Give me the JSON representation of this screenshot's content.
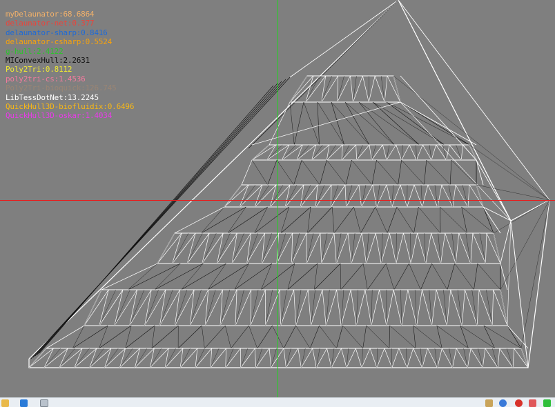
{
  "timings": [
    {
      "label": "myDelaunator:68.6864",
      "color": "#f0b06a"
    },
    {
      "label": "delaunator-net:0.377",
      "color": "#e8453c"
    },
    {
      "label": "delaunator-sharp:0.8416",
      "color": "#1f6bd6"
    },
    {
      "label": "delaunator-csharp:0.5524",
      "color": "#f5a20f"
    },
    {
      "label": "g-hull:2.4122",
      "color": "#2bc52b"
    },
    {
      "label": "MIConvexHull:2.2631",
      "color": "#111111"
    },
    {
      "label": "Poly2Tri:0.8112",
      "color": "#f0ea32"
    },
    {
      "label": "poly2tri-cs:1.4536",
      "color": "#f27b9e"
    },
    {
      "label": "Poly2Tri-bioquick:126.745",
      "color": "#9a8574"
    },
    {
      "label": "LibTessDotNet:13.2245",
      "color": "#ffffff"
    },
    {
      "label": "QuickHull3D-biofluidix:0.6496",
      "color": "#f7b716"
    },
    {
      "label": "QuickHull3D-oskar:1.4034",
      "color": "#e83be8"
    }
  ],
  "colors": {
    "background": "#7f7f7f",
    "mesh_primary": "#ffffff",
    "mesh_secondary": "#111111",
    "axis_vertical": "#1fd41f",
    "axis_horizontal": "#e81c1c",
    "taskbar": "#e9eef3"
  },
  "taskbar": {
    "left_icons": [
      "explorer-icon",
      "visual-studio-icon",
      "app-window-icon"
    ],
    "right_icons": [
      "tray-icon-1",
      "tray-icon-2",
      "tray-icon-3",
      "tray-icon-4",
      "tray-icon-5"
    ]
  }
}
